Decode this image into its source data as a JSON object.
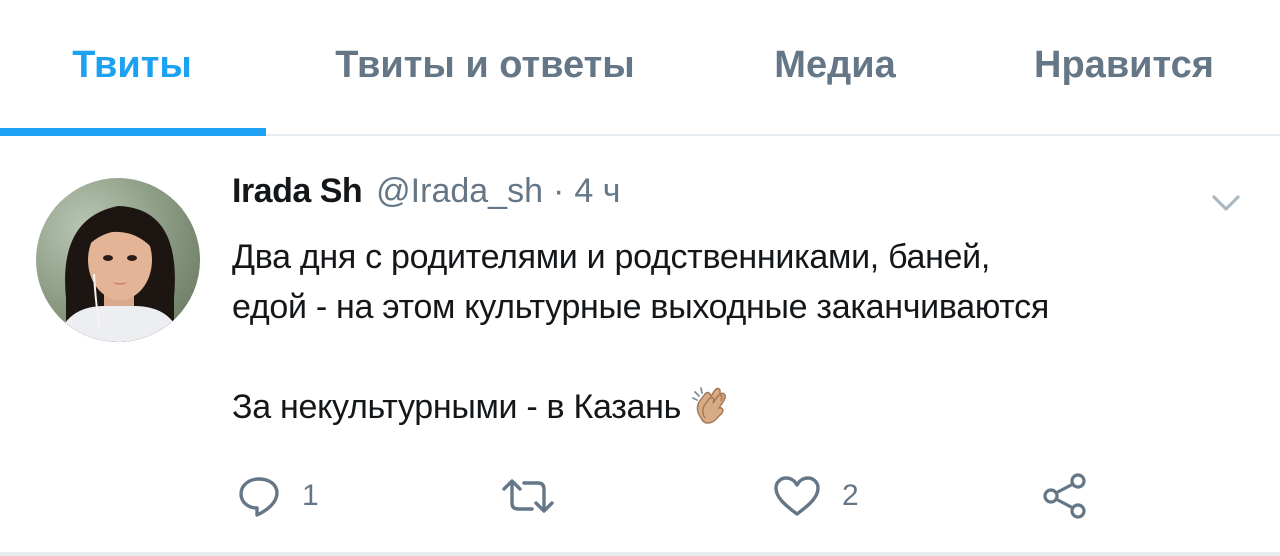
{
  "tabs": [
    {
      "label": "Твиты",
      "active": true
    },
    {
      "label": "Твиты и ответы",
      "active": false
    },
    {
      "label": "Медиа",
      "active": false
    },
    {
      "label": "Нравится",
      "active": false
    }
  ],
  "tweet": {
    "display_name": "Irada Sh",
    "handle": "@Irada_sh",
    "separator": "·",
    "time": "4 ч",
    "text_line1": "Два дня с родителями и родственниками, баней,",
    "text_line2": "едой - на этом культурные выходные заканчиваются",
    "text_line3": "За некультурными - в Казань",
    "emoji": "clapping-hands-icon",
    "reply_count": "1",
    "retweet_count": "",
    "like_count": "2"
  },
  "colors": {
    "accent": "#1da1f2",
    "muted": "#657786",
    "text": "#14171a",
    "border": "#e6ecf0"
  }
}
